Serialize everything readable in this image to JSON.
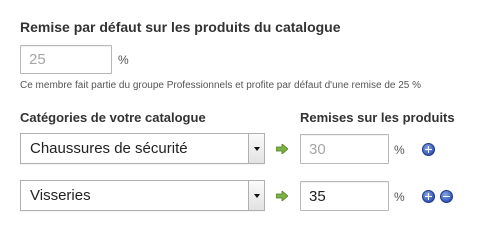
{
  "default_discount": {
    "title": "Remise par défaut sur les produits du catalogue",
    "placeholder": "25",
    "unit": "%",
    "note": "Ce membre fait partie du groupe Professionnels et profite par défaut d'une remise de 25 %"
  },
  "columns": {
    "categories_label": "Catégories de votre catalogue",
    "discounts_label": "Remises sur les produits"
  },
  "rows": [
    {
      "category": "Chaussures de sécurité",
      "discount_placeholder": "30",
      "discount_value": "",
      "unit": "%"
    },
    {
      "category": "Visseries",
      "discount_placeholder": "",
      "discount_value": "35",
      "unit": "%"
    }
  ],
  "colors": {
    "arrow": "#7cb342",
    "action_button": "#3357b8"
  },
  "icons": {
    "arrow": "arrow-right-icon",
    "add": "plus-circle-icon",
    "remove": "minus-circle-icon"
  }
}
